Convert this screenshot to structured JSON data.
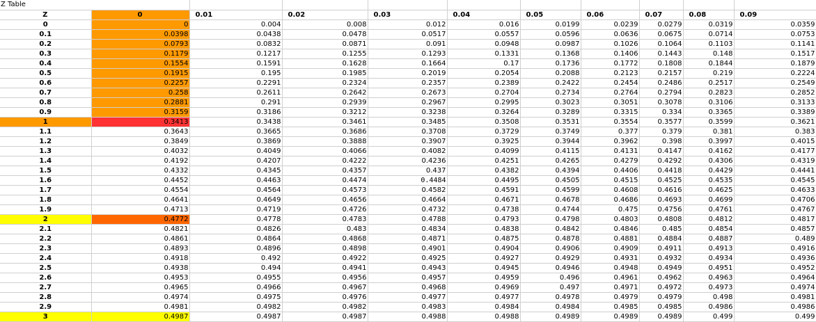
{
  "sheet": {
    "title": "Z Table",
    "headers": [
      "Z",
      "0",
      "0.01",
      "0.02",
      "0.03",
      "0.04",
      "0.05",
      "0.06",
      "0.07",
      "0.08",
      "0.09"
    ],
    "highlight_colors": {
      "orange": "#ff9900",
      "red": "#ff3333",
      "dark_orange": "#ff6600",
      "yellow": "#ffff00"
    },
    "rows": [
      {
        "z": "0",
        "cells": [
          "0",
          "0.004",
          "0.008",
          "0.012",
          "0.016",
          "0.0199",
          "0.0239",
          "0.0279",
          "0.0319",
          "0.0359"
        ]
      },
      {
        "z": "0.1",
        "cells": [
          "0.0398",
          "0.0438",
          "0.0478",
          "0.0517",
          "0.0557",
          "0.0596",
          "0.0636",
          "0.0675",
          "0.0714",
          "0.0753"
        ]
      },
      {
        "z": "0.2",
        "cells": [
          "0.0793",
          "0.0832",
          "0.0871",
          "0.091",
          "0.0948",
          "0.0987",
          "0.1026",
          "0.1064",
          "0.1103",
          "0.1141"
        ]
      },
      {
        "z": "0.3",
        "cells": [
          "0.1179",
          "0.1217",
          "0.1255",
          "0.1293",
          "0.1331",
          "0.1368",
          "0.1406",
          "0.1443",
          "0.148",
          "0.1517"
        ]
      },
      {
        "z": "0.4",
        "cells": [
          "0.1554",
          "0.1591",
          "0.1628",
          "0.1664",
          "0.17",
          "0.1736",
          "0.1772",
          "0.1808",
          "0.1844",
          "0.1879"
        ]
      },
      {
        "z": "0.5",
        "cells": [
          "0.1915",
          "0.195",
          "0.1985",
          "0.2019",
          "0.2054",
          "0.2088",
          "0.2123",
          "0.2157",
          "0.219",
          "0.2224"
        ]
      },
      {
        "z": "0.6",
        "cells": [
          "0.2257",
          "0.2291",
          "0.2324",
          "0.2357",
          "0.2389",
          "0.2422",
          "0.2454",
          "0.2486",
          "0.2517",
          "0.2549"
        ]
      },
      {
        "z": "0.7",
        "cells": [
          "0.258",
          "0.2611",
          "0.2642",
          "0.2673",
          "0.2704",
          "0.2734",
          "0.2764",
          "0.2794",
          "0.2823",
          "0.2852"
        ]
      },
      {
        "z": "0.8",
        "cells": [
          "0.2881",
          "0.291",
          "0.2939",
          "0.2967",
          "0.2995",
          "0.3023",
          "0.3051",
          "0.3078",
          "0.3106",
          "0.3133"
        ]
      },
      {
        "z": "0.9",
        "cells": [
          "0.3159",
          "0.3186",
          "0.3212",
          "0.3238",
          "0.3264",
          "0.3289",
          "0.3315",
          "0.334",
          "0.3365",
          "0.3389"
        ]
      },
      {
        "z": "1",
        "cells": [
          "0.3413",
          "0.3438",
          "0.3461",
          "0.3485",
          "0.3508",
          "0.3531",
          "0.3554",
          "0.3577",
          "0.3599",
          "0.3621"
        ]
      },
      {
        "z": "1.1",
        "cells": [
          "0.3643",
          "0.3665",
          "0.3686",
          "0.3708",
          "0.3729",
          "0.3749",
          "0.377",
          "0.379",
          "0.381",
          "0.383"
        ]
      },
      {
        "z": "1.2",
        "cells": [
          "0.3849",
          "0.3869",
          "0.3888",
          "0.3907",
          "0.3925",
          "0.3944",
          "0.3962",
          "0.398",
          "0.3997",
          "0.4015"
        ]
      },
      {
        "z": "1.3",
        "cells": [
          "0.4032",
          "0.4049",
          "0.4066",
          "0.4082",
          "0.4099",
          "0.4115",
          "0.4131",
          "0.4147",
          "0.4162",
          "0.4177"
        ]
      },
      {
        "z": "1.4",
        "cells": [
          "0.4192",
          "0.4207",
          "0.4222",
          "0.4236",
          "0.4251",
          "0.4265",
          "0.4279",
          "0.4292",
          "0.4306",
          "0.4319"
        ]
      },
      {
        "z": "1.5",
        "cells": [
          "0.4332",
          "0.4345",
          "0.4357",
          "0.437",
          "0.4382",
          "0.4394",
          "0.4406",
          "0.4418",
          "0.4429",
          "0.4441"
        ]
      },
      {
        "z": "1.6",
        "cells": [
          "0.4452",
          "0.4463",
          "0.4474",
          "0.4484",
          "0.4495",
          "0.4505",
          "0.4515",
          "0.4525",
          "0.4535",
          "0.4545"
        ]
      },
      {
        "z": "1.7",
        "cells": [
          "0.4554",
          "0.4564",
          "0.4573",
          "0.4582",
          "0.4591",
          "0.4599",
          "0.4608",
          "0.4616",
          "0.4625",
          "0.4633"
        ]
      },
      {
        "z": "1.8",
        "cells": [
          "0.4641",
          "0.4649",
          "0.4656",
          "0.4664",
          "0.4671",
          "0.4678",
          "0.4686",
          "0.4693",
          "0.4699",
          "0.4706"
        ]
      },
      {
        "z": "1.9",
        "cells": [
          "0.4713",
          "0.4719",
          "0.4726",
          "0.4732",
          "0.4738",
          "0.4744",
          "0.475",
          "0.4756",
          "0.4761",
          "0.4767"
        ]
      },
      {
        "z": "2",
        "cells": [
          "0.4772",
          "0.4778",
          "0.4783",
          "0.4788",
          "0.4793",
          "0.4798",
          "0.4803",
          "0.4808",
          "0.4812",
          "0.4817"
        ]
      },
      {
        "z": "2.1",
        "cells": [
          "0.4821",
          "0.4826",
          "0.483",
          "0.4834",
          "0.4838",
          "0.4842",
          "0.4846",
          "0.485",
          "0.4854",
          "0.4857"
        ]
      },
      {
        "z": "2.2",
        "cells": [
          "0.4861",
          "0.4864",
          "0.4868",
          "0.4871",
          "0.4875",
          "0.4878",
          "0.4881",
          "0.4884",
          "0.4887",
          "0.489"
        ]
      },
      {
        "z": "2.3",
        "cells": [
          "0.4893",
          "0.4896",
          "0.4898",
          "0.4901",
          "0.4904",
          "0.4906",
          "0.4909",
          "0.4911",
          "0.4913",
          "0.4916"
        ]
      },
      {
        "z": "2.4",
        "cells": [
          "0.4918",
          "0.492",
          "0.4922",
          "0.4925",
          "0.4927",
          "0.4929",
          "0.4931",
          "0.4932",
          "0.4934",
          "0.4936"
        ]
      },
      {
        "z": "2.5",
        "cells": [
          "0.4938",
          "0.494",
          "0.4941",
          "0.4943",
          "0.4945",
          "0.4946",
          "0.4948",
          "0.4949",
          "0.4951",
          "0.4952"
        ]
      },
      {
        "z": "2.6",
        "cells": [
          "0.4953",
          "0.4955",
          "0.4956",
          "0.4957",
          "0.4959",
          "0.496",
          "0.4961",
          "0.4962",
          "0.4963",
          "0.4964"
        ]
      },
      {
        "z": "2.7",
        "cells": [
          "0.4965",
          "0.4966",
          "0.4967",
          "0.4968",
          "0.4969",
          "0.497",
          "0.4971",
          "0.4972",
          "0.4973",
          "0.4974"
        ]
      },
      {
        "z": "2.8",
        "cells": [
          "0.4974",
          "0.4975",
          "0.4976",
          "0.4977",
          "0.4977",
          "0.4978",
          "0.4979",
          "0.4979",
          "0.498",
          "0.4981"
        ]
      },
      {
        "z": "2.9",
        "cells": [
          "0.4981",
          "0.4982",
          "0.4982",
          "0.4983",
          "0.4984",
          "0.4984",
          "0.4985",
          "0.4985",
          "0.4986",
          "0.4986"
        ]
      },
      {
        "z": "3",
        "cells": [
          "0.4987",
          "0.4987",
          "0.4987",
          "0.4988",
          "0.4988",
          "0.4989",
          "0.4989",
          "0.4989",
          "0.499",
          "0.499"
        ]
      }
    ]
  }
}
